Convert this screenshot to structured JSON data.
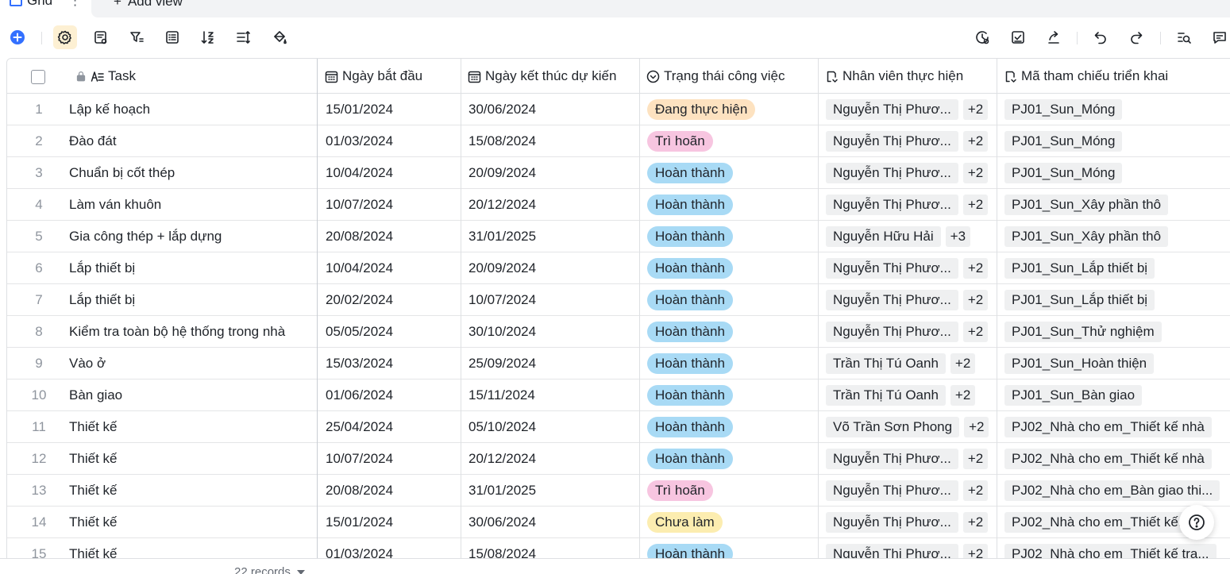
{
  "tabs": {
    "active_label": "Grid",
    "add_view_label": "Add view"
  },
  "toolbar": {
    "left_icons": [
      "add-record-icon",
      "settings-icon",
      "field-config-icon",
      "filter-icon",
      "group-icon",
      "sort-icon",
      "row-height-icon",
      "paint-bucket-icon"
    ],
    "right_icons": [
      "history-icon",
      "checklist-icon",
      "share-icon",
      "undo-icon",
      "redo-icon",
      "search-icon",
      "comment-icon"
    ]
  },
  "columns": {
    "task": "Task",
    "start": "Ngày bắt đầu",
    "end": "Ngày kết thúc dự kiến",
    "status": "Trạng thái công việc",
    "staff": "Nhân viên thực hiện",
    "ref": "Mã tham chiếu triển khai"
  },
  "status_colors": {
    "Đang thực hiện": "#fde2c0",
    "Trì hoãn": "#f7c5e0",
    "Hoàn thành": "#a8daf5",
    "Chưa làm": "#fcedb0"
  },
  "rows": [
    {
      "n": "1",
      "task": "Lập kế hoạch",
      "start": "15/01/2024",
      "end": "30/06/2024",
      "status": "Đang thực hiện",
      "staff": "Nguyễn Thị Phươ...",
      "more": "+2",
      "ref": "PJ01_Sun_Móng"
    },
    {
      "n": "2",
      "task": "Đào đát",
      "start": "01/03/2024",
      "end": "15/08/2024",
      "status": "Trì hoãn",
      "staff": "Nguyễn Thị Phươ...",
      "more": "+2",
      "ref": "PJ01_Sun_Móng"
    },
    {
      "n": "3",
      "task": "Chuẩn bị cốt thép",
      "start": "10/04/2024",
      "end": "20/09/2024",
      "status": "Hoàn thành",
      "staff": "Nguyễn Thị Phươ...",
      "more": "+2",
      "ref": "PJ01_Sun_Móng"
    },
    {
      "n": "4",
      "task": "Làm ván khuôn",
      "start": "10/07/2024",
      "end": "20/12/2024",
      "status": "Hoàn thành",
      "staff": "Nguyễn Thị Phươ...",
      "more": "+2",
      "ref": "PJ01_Sun_Xây phần thô"
    },
    {
      "n": "5",
      "task": "Gia công thép + lắp dựng",
      "start": "20/08/2024",
      "end": "31/01/2025",
      "status": "Hoàn thành",
      "staff": "Nguyễn Hữu Hải",
      "more": "+3",
      "ref": "PJ01_Sun_Xây phần thô"
    },
    {
      "n": "6",
      "task": "Lắp thiết bị",
      "start": "10/04/2024",
      "end": "20/09/2024",
      "status": "Hoàn thành",
      "staff": "Nguyễn Thị Phươ...",
      "more": "+2",
      "ref": "PJ01_Sun_Lắp thiết bị"
    },
    {
      "n": "7",
      "task": "Lắp thiết bị",
      "start": "20/02/2024",
      "end": "10/07/2024",
      "status": "Hoàn thành",
      "staff": "Nguyễn Thị Phươ...",
      "more": "+2",
      "ref": "PJ01_Sun_Lắp thiết bị"
    },
    {
      "n": "8",
      "task": "Kiểm tra toàn bộ hệ thống trong nhà",
      "start": "05/05/2024",
      "end": "30/10/2024",
      "status": "Hoàn thành",
      "staff": "Nguyễn Thị Phươ...",
      "more": "+2",
      "ref": "PJ01_Sun_Thử nghiệm"
    },
    {
      "n": "9",
      "task": "Vào ở",
      "start": "15/03/2024",
      "end": "25/09/2024",
      "status": "Hoàn thành",
      "staff": "Trần Thị Tú Oanh",
      "more": "+2",
      "ref": "PJ01_Sun_Hoàn thiện"
    },
    {
      "n": "10",
      "task": "Bàn giao",
      "start": "01/06/2024",
      "end": "15/11/2024",
      "status": "Hoàn thành",
      "staff": "Trần Thị Tú Oanh",
      "more": "+2",
      "ref": "PJ01_Sun_Bàn giao"
    },
    {
      "n": "11",
      "task": "Thiết kế",
      "start": "25/04/2024",
      "end": "05/10/2024",
      "status": "Hoàn thành",
      "staff": "Võ Trần Sơn Phong",
      "more": "+2",
      "ref": "PJ02_Nhà cho em_Thiết kế nhà"
    },
    {
      "n": "12",
      "task": "Thiết kế",
      "start": "10/07/2024",
      "end": "20/12/2024",
      "status": "Hoàn thành",
      "staff": "Nguyễn Thị Phươ...",
      "more": "+2",
      "ref": "PJ02_Nhà cho em_Thiết kế nhà"
    },
    {
      "n": "13",
      "task": "Thiết kế",
      "start": "20/08/2024",
      "end": "31/01/2025",
      "status": "Trì hoãn",
      "staff": "Nguyễn Thị Phươ...",
      "more": "+2",
      "ref": "PJ02_Nhà cho em_Bàn giao thi..."
    },
    {
      "n": "14",
      "task": "Thiết kế",
      "start": "15/01/2024",
      "end": "30/06/2024",
      "status": "Chưa làm",
      "staff": "Nguyễn Thị Phươ...",
      "more": "+2",
      "ref": "PJ02_Nhà cho em_Thiết kế..."
    },
    {
      "n": "15",
      "task": "Thiết kế",
      "start": "01/03/2024",
      "end": "15/08/2024",
      "status": "Hoàn thành",
      "staff": "Nguyễn Thị Phươ...",
      "more": "+2",
      "ref": "PJ02_Nhà cho em_Thiết kế tra..."
    }
  ],
  "footer": {
    "records": "22 records"
  }
}
